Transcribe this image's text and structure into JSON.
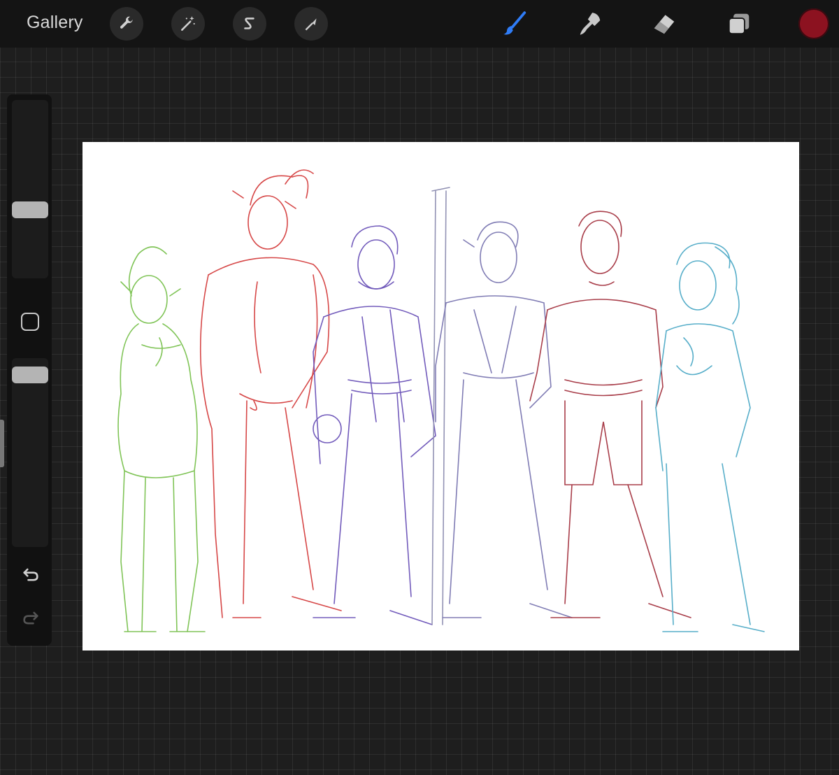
{
  "topbar": {
    "gallery_label": "Gallery",
    "left_tools": [
      {
        "name": "actions",
        "icon": "wrench-icon"
      },
      {
        "name": "adjustments",
        "icon": "magic-wand-icon"
      },
      {
        "name": "selection",
        "icon": "selection-s-icon"
      },
      {
        "name": "transform",
        "icon": "arrow-cursor-icon"
      }
    ],
    "right_tools": [
      {
        "name": "brush",
        "icon": "brush-icon",
        "active": true
      },
      {
        "name": "smudge",
        "icon": "smudge-icon",
        "active": false
      },
      {
        "name": "eraser",
        "icon": "eraser-icon",
        "active": false
      },
      {
        "name": "layers",
        "icon": "layers-icon",
        "active": false
      }
    ],
    "current_color": "#8c1220",
    "active_color": "#2f7cf6"
  },
  "sidebar": {
    "brush_size_level": 0.55,
    "opacity_level": 1.0,
    "modify_icon": "square-icon",
    "undo_icon": "undo-icon",
    "redo_icon": "redo-icon"
  },
  "canvas": {
    "subject": "character-lineup-sketch",
    "figure_colors": [
      "#6aba3a",
      "#d02828",
      "#5a3fb0",
      "#6a66a8",
      "#9a1c2a",
      "#3aa0c0"
    ]
  }
}
